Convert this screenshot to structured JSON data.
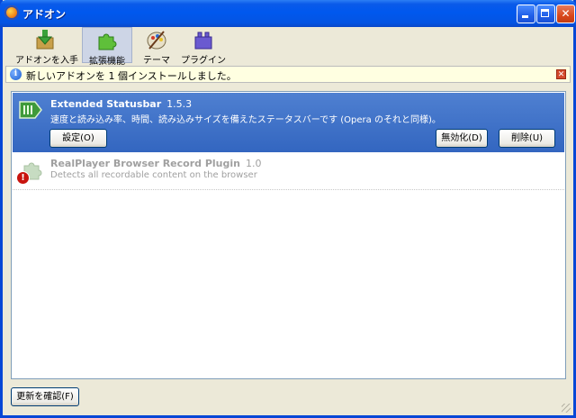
{
  "window": {
    "title": "アドオン"
  },
  "toolbar": {
    "categories": [
      {
        "label": "アドオンを入手",
        "icon": "download-puzzle-icon",
        "selected": false
      },
      {
        "label": "拡張機能",
        "icon": "puzzle-piece-icon",
        "selected": true
      },
      {
        "label": "テーマ",
        "icon": "palette-icon",
        "selected": false
      },
      {
        "label": "プラグイン",
        "icon": "plugin-block-icon",
        "selected": false
      }
    ]
  },
  "notification": {
    "text": "新しいアドオンを 1 個インストールしました。",
    "icon": "info-icon",
    "close_icon": "close-icon"
  },
  "addons": [
    {
      "name": "Extended Statusbar",
      "version": "1.5.3",
      "description": "速度と読み込み率、時間、読み込みサイズを備えたステータスバーです (Opera のそれと同様)。",
      "selected": true,
      "buttons": {
        "settings": "設定(O)",
        "disable": "無効化(D)",
        "uninstall": "削除(U)"
      }
    },
    {
      "name": "RealPlayer Browser Record Plugin",
      "version": "1.0",
      "description": "Detects all recordable content on the browser",
      "selected": false,
      "disabled": true
    }
  ],
  "footer": {
    "find_updates_label": "更新を確認(F)"
  },
  "colors": {
    "titlebar": "#0058ee",
    "selection": "#3e70c8",
    "window_bg": "#ece9d8",
    "notify_bg": "#ffffe1"
  }
}
